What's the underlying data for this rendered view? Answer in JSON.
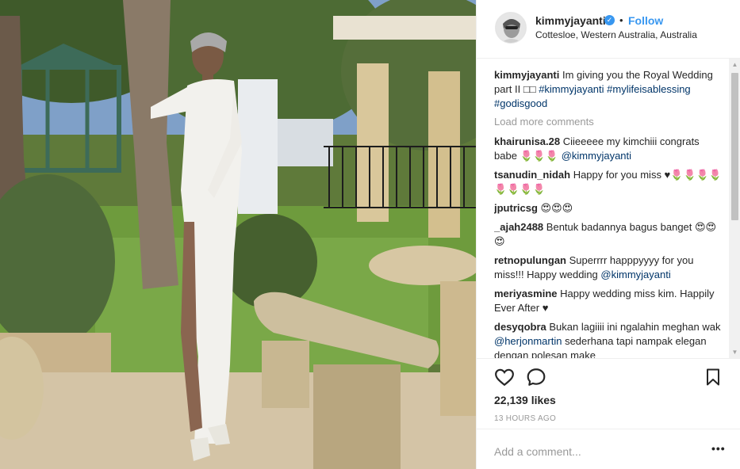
{
  "header": {
    "username": "kimmyjayanti",
    "separator": "•",
    "follow_label": "Follow",
    "location": "Cottesloe, Western Australia, Australia"
  },
  "caption": {
    "username": "kimmyjayanti",
    "text": "Im giving you the Royal Wedding part II □□",
    "tags": [
      "#kimmyjayanti",
      "#mylifeisablessing",
      "#godisgood"
    ]
  },
  "load_more_label": "Load more comments",
  "comments": [
    {
      "user": "khairunisa.28",
      "text": "Ciieeeee my kimchiii congrats babe 🌷🌷🌷",
      "mention": "@kimmyjayanti"
    },
    {
      "user": "tsanudin_nidah",
      "text": "Happy for you miss ♥🌷🌷🌷🌷🌷🌷🌷🌷",
      "mention": ""
    },
    {
      "user": "jputricsg",
      "text": "😍😍😍",
      "mention": ""
    },
    {
      "user": "_ajah2488",
      "text": "Bentuk badannya bagus banget 😍😍😍",
      "mention": ""
    },
    {
      "user": "retnopulungan",
      "text": "Superrrr happpyyyy for you miss!!! Happy wedding",
      "mention": "@kimmyjayanti"
    },
    {
      "user": "meriyasmine",
      "text": "Happy wedding miss kim. Happily Ever After ♥",
      "mention": ""
    },
    {
      "user": "desyqobra",
      "text": "Bukan lagiiii ini ngalahin meghan wak",
      "mention": "@herjonmartin",
      "tail": "sederhana tapi nampak elegan dengan polesan make"
    }
  ],
  "likes": "22,139 likes",
  "timestamp": "13 HOURS AGO",
  "add_comment_placeholder": "Add a comment...",
  "more_label": "•••",
  "colors": {
    "link_blue": "#3897f0",
    "hashtag": "#003569",
    "muted": "#999999",
    "text": "#262626"
  },
  "icons": [
    "heart-icon",
    "comment-icon",
    "bookmark-icon",
    "verified-badge-icon"
  ]
}
